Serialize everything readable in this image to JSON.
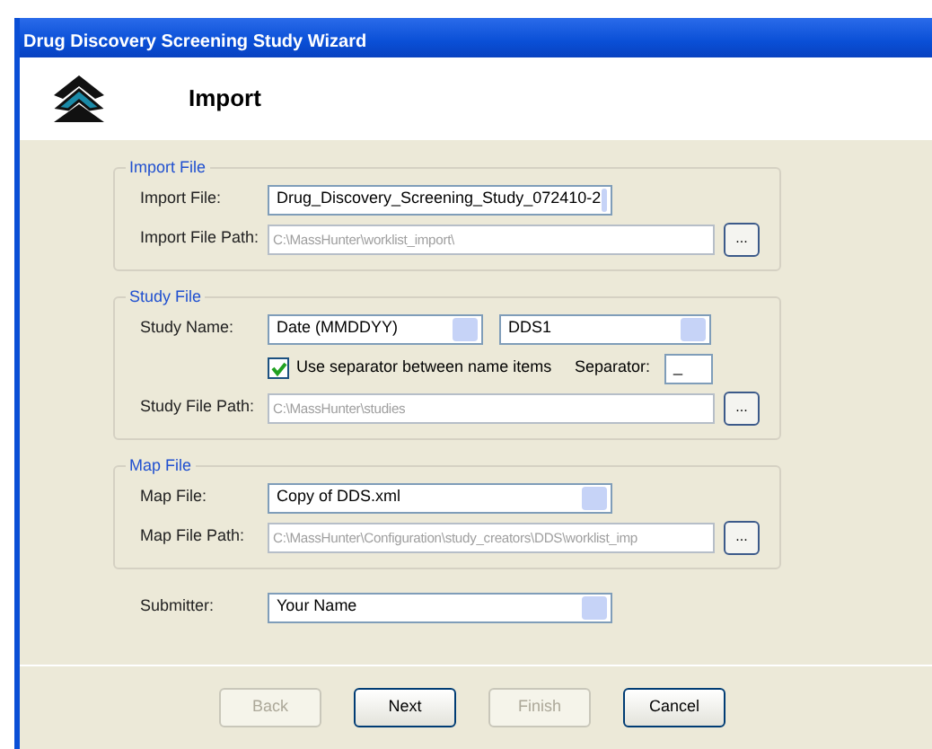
{
  "window": {
    "title": "Drug Discovery Screening Study Wizard"
  },
  "header": {
    "title": "Import"
  },
  "sections": [
    {
      "title": "Import File",
      "fields": [
        {
          "kind": "combo",
          "label": "Import File:",
          "value": "Drug_Discovery_Screening_Study_072410-2"
        },
        {
          "kind": "path",
          "label": "Import File Path:",
          "value": "C:\\MassHunter\\worklist_import\\",
          "disabled": true,
          "button": "..."
        }
      ]
    },
    {
      "title": "Study File",
      "fields": [
        {
          "kind": "combo-pair",
          "label": "Study Name:",
          "values": [
            "Date (MMDDYY)",
            "DDS1"
          ]
        },
        {
          "kind": "checkbox",
          "label": "Use separator between name items",
          "checked": true,
          "field_label": "Separator:",
          "field_value": "_"
        },
        {
          "kind": "path",
          "label": "Study File Path:",
          "value": "C:\\MassHunter\\studies",
          "disabled": true,
          "button": "..."
        }
      ]
    },
    {
      "title": "Map File",
      "fields": [
        {
          "kind": "combo",
          "label": "Map File:",
          "value": "Copy of DDS.xml"
        },
        {
          "kind": "path",
          "label": "Map File Path:",
          "value": "C:\\MassHunter\\Configuration\\study_creators\\DDS\\worklist_imp",
          "disabled": true,
          "button": "..."
        }
      ]
    }
  ],
  "submitter": {
    "kind": "combo",
    "label": "Submitter:",
    "value": "Your Name"
  },
  "buttons": [
    {
      "label": "Back",
      "disabled": true
    },
    {
      "label": "Next",
      "disabled": false
    },
    {
      "label": "Finish",
      "disabled": true
    },
    {
      "label": "Cancel",
      "disabled": false
    }
  ]
}
